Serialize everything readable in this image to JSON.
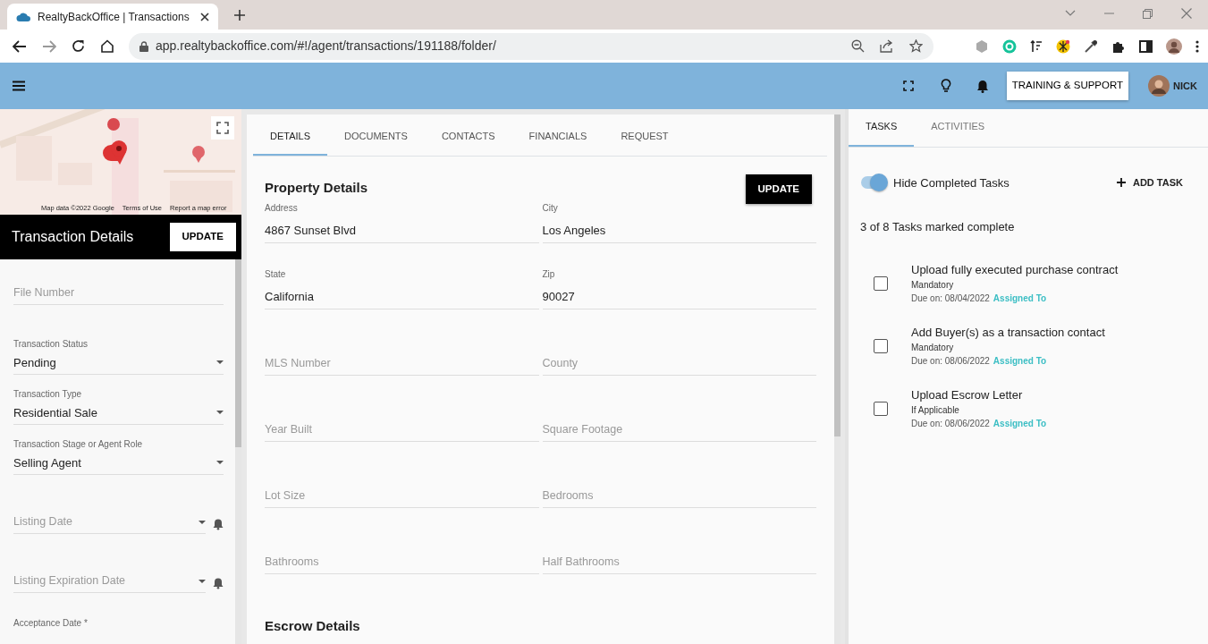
{
  "browser": {
    "tab_title": "RealtyBackOffice | Transactions",
    "url": "app.realtybackoffice.com/#!/agent/transactions/191188/folder/"
  },
  "app_bar": {
    "support_button": "TRAINING & SUPPORT",
    "user_name": "NICK"
  },
  "map": {
    "attribution": "Map data ©2022 Google",
    "terms": "Terms of Use",
    "report": "Report a map error"
  },
  "transaction_details": {
    "title": "Transaction Details",
    "update_button": "UPDATE",
    "fields": [
      {
        "kind": "text",
        "placeholder": "File Number"
      },
      {
        "kind": "select",
        "label": "Transaction Status",
        "value": "Pending"
      },
      {
        "kind": "select",
        "label": "Transaction Type",
        "value": "Residential Sale"
      },
      {
        "kind": "select",
        "label": "Transaction Stage or Agent Role",
        "value": "Selling Agent"
      },
      {
        "kind": "date",
        "placeholder": "Listing Date"
      },
      {
        "kind": "date",
        "placeholder": "Listing Expiration Date"
      },
      {
        "kind": "label",
        "label": "Acceptance Date *"
      }
    ]
  },
  "detail_tabs": [
    {
      "label": "DETAILS",
      "selected": true
    },
    {
      "label": "DOCUMENTS",
      "selected": false
    },
    {
      "label": "CONTACTS",
      "selected": false
    },
    {
      "label": "FINANCIALS",
      "selected": false
    },
    {
      "label": "REQUEST",
      "selected": false
    }
  ],
  "property_details": {
    "title": "Property Details",
    "update_button": "UPDATE",
    "fields": [
      {
        "label": "Address",
        "value": "4867 Sunset Blvd"
      },
      {
        "label": "City",
        "value": "Los Angeles"
      },
      {
        "label": "State",
        "value": "California"
      },
      {
        "label": "Zip",
        "value": "90027"
      },
      {
        "placeholder": "MLS Number"
      },
      {
        "placeholder": "County"
      },
      {
        "placeholder": "Year Built"
      },
      {
        "placeholder": "Square Footage"
      },
      {
        "placeholder": "Lot Size"
      },
      {
        "placeholder": "Bedrooms"
      },
      {
        "placeholder": "Bathrooms"
      },
      {
        "placeholder": "Half Bathrooms"
      }
    ]
  },
  "escrow_details": {
    "title": "Escrow Details"
  },
  "side_tabs": [
    {
      "label": "TASKS",
      "selected": true
    },
    {
      "label": "ACTIVITIES",
      "selected": false
    }
  ],
  "tasks_panel": {
    "hide_completed": {
      "label": "Hide Completed Tasks",
      "on": true
    },
    "add_task": "ADD TASK",
    "summary": "3 of 8 Tasks marked complete",
    "tasks": [
      {
        "title": "Upload fully executed purchase contract",
        "requirement": "Mandatory",
        "due": "Due on: 08/04/2022",
        "assigned": "Assigned To",
        "checked": false
      },
      {
        "title": "Add Buyer(s) as a transaction contact",
        "requirement": "Mandatory",
        "due": "Due on: 08/06/2022",
        "assigned": "Assigned To",
        "checked": false
      },
      {
        "title": "Upload Escrow Letter",
        "requirement": "If Applicable",
        "due": "Due on: 08/06/2022",
        "assigned": "Assigned To",
        "checked": false
      }
    ]
  }
}
